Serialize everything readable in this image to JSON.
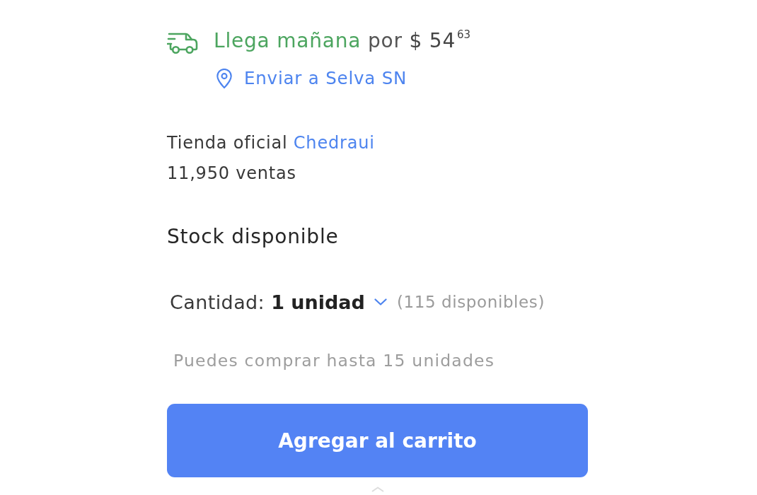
{
  "shipping": {
    "arrival": "Llega mañana",
    "price_prefix": "por",
    "price": "$ 54$^{63}$",
    "destination": "Enviar a Selva SN"
  },
  "seller": {
    "label": "Tienda oficial",
    "store": "Chedraui",
    "sales": "11,950 ventas"
  },
  "stock": {
    "title": "Stock disponible"
  },
  "quantity": {
    "label": "Cantidad:",
    "value": "1 unidad",
    "available": "(115 disponibles)",
    "limit": "Puedes comprar hasta 15 unidades"
  },
  "buttons": [
    {
      "label": "Agregar al carrito"
    }
  ]
}
